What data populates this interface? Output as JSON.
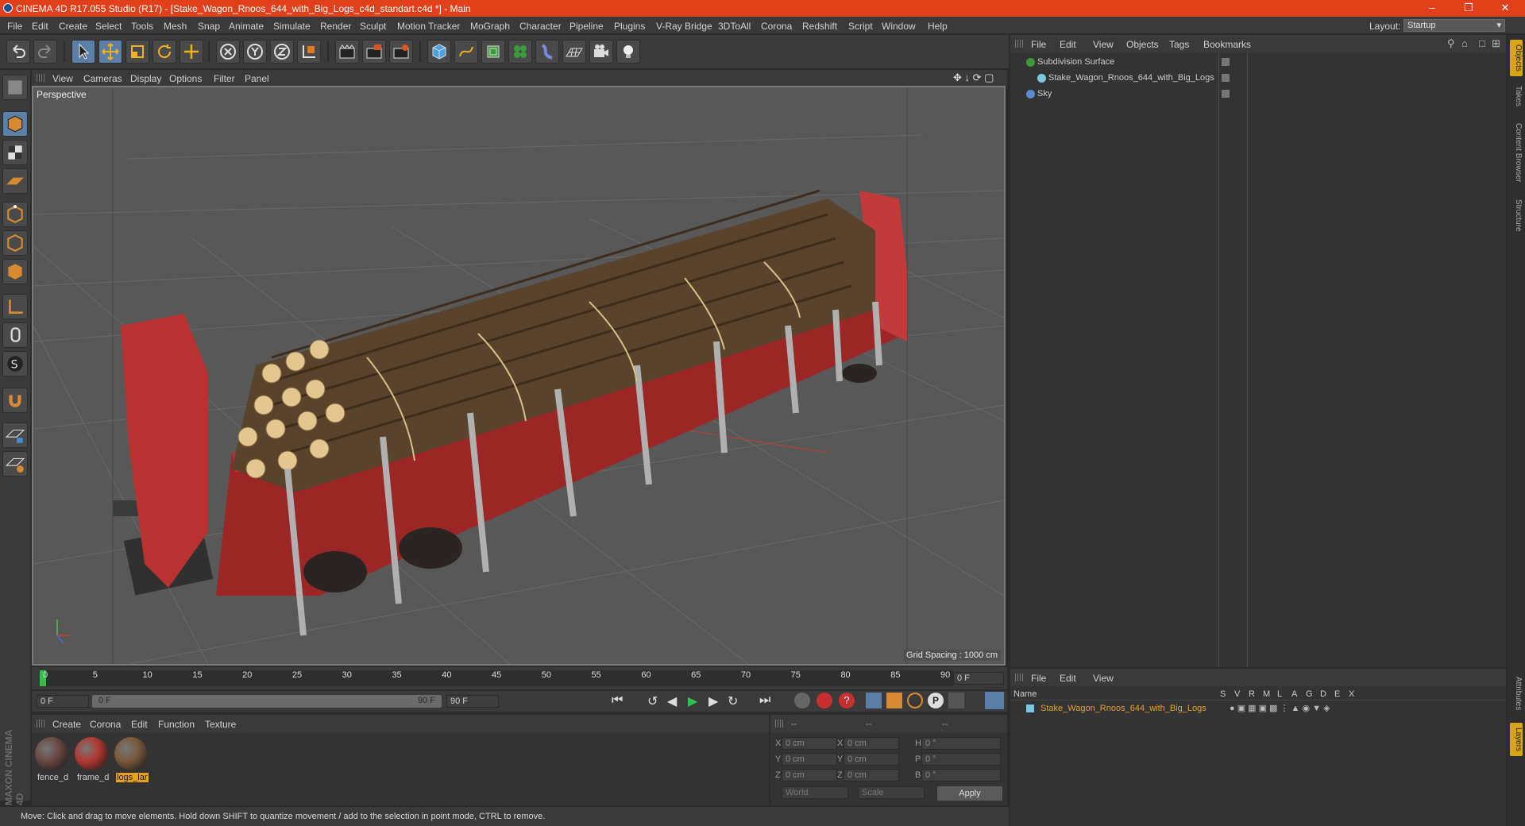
{
  "app": {
    "title": "CINEMA 4D R17.055 Studio (R17) - [Stake_Wagon_Rnoos_644_with_Big_Logs_c4d_standart.c4d *] - Main"
  },
  "menu": [
    "File",
    "Edit",
    "Create",
    "Select",
    "Tools",
    "Mesh",
    "Snap",
    "Animate",
    "Simulate",
    "Render",
    "Sculpt",
    "Motion Tracker",
    "MoGraph",
    "Character",
    "Pipeline",
    "Plugins",
    "V-Ray Bridge",
    "3DToAll",
    "Corona",
    "Redshift",
    "Script",
    "Window",
    "Help"
  ],
  "layout": {
    "label": "Layout:",
    "value": "Startup"
  },
  "toolbar_icons": [
    "undo-icon",
    "redo-icon",
    "select-arrow-icon",
    "move-icon",
    "scale-icon",
    "rotate-icon",
    "move-alt-icon",
    "x-axis-icon",
    "y-axis-icon",
    "z-axis-icon",
    "coordinate-system-icon",
    "render-view-icon",
    "render-picture-viewer-icon",
    "render-settings-icon",
    "cube-primitive-icon",
    "pen-spline-icon",
    "subdivision-icon",
    "cloner-icon",
    "deformer-icon",
    "floor-icon",
    "camera-icon",
    "light-icon"
  ],
  "left_tool_icons": [
    "make-editable-icon",
    "model-mode-icon",
    "texture-mode-icon",
    "workplane-mode-icon",
    "points-mode-icon",
    "edges-mode-icon",
    "polygons-mode-icon",
    "axis-mode-icon",
    "tweak-mode-icon",
    "snap-icon",
    "magnet-icon",
    "workplane-lock-icon",
    "solo-icon"
  ],
  "viewport": {
    "menu": [
      "View",
      "Cameras",
      "Display",
      "Options",
      "Filter",
      "Panel"
    ],
    "label": "Perspective",
    "grid_spacing": "Grid Spacing : 1000 cm"
  },
  "timeline": {
    "ticks": [
      "0",
      "5",
      "10",
      "15",
      "20",
      "25",
      "30",
      "35",
      "40",
      "45",
      "50",
      "55",
      "60",
      "65",
      "70",
      "75",
      "80",
      "85",
      "90"
    ],
    "current_frame": "0 F",
    "start_frame": "0 F",
    "range_start": "0 F",
    "range_end": "90 F",
    "end_frame": "90 F"
  },
  "materials": {
    "menu": [
      "Create",
      "Corona",
      "Edit",
      "Function",
      "Texture"
    ],
    "items": [
      {
        "name": "fence_d",
        "color": "#6a4a44"
      },
      {
        "name": "frame_d",
        "color": "#b23a34"
      },
      {
        "name": "logs_lar",
        "color": "#7a5a3e",
        "selected": true
      }
    ]
  },
  "coordinates": {
    "headers": [
      "--",
      "--",
      "--"
    ],
    "rows": [
      {
        "a": "X",
        "av": "0 cm",
        "b": "X",
        "bv": "0 cm",
        "c": "H",
        "cv": "0 °"
      },
      {
        "a": "Y",
        "av": "0 cm",
        "b": "Y",
        "bv": "0 cm",
        "c": "P",
        "cv": "0 °"
      },
      {
        "a": "Z",
        "av": "0 cm",
        "b": "Z",
        "bv": "0 cm",
        "c": "B",
        "cv": "0 °"
      }
    ],
    "mode1": "World",
    "mode2": "Scale",
    "apply": "Apply"
  },
  "status": "Move: Click and drag to move elements. Hold down SHIFT to quantize movement / add to the selection in point mode, CTRL to remove.",
  "objects": {
    "menu": [
      "File",
      "Edit",
      "View",
      "Objects",
      "Tags",
      "Bookmarks"
    ],
    "items": [
      {
        "name": "Subdivision Surface",
        "indent": 0
      },
      {
        "name": "Stake_Wagon_Rnoos_644_with_Big_Logs",
        "indent": 1
      },
      {
        "name": "Sky",
        "indent": 0
      }
    ]
  },
  "layers": {
    "menu": [
      "File",
      "Edit",
      "View"
    ],
    "name_header": "Name",
    "col_headers": [
      "S",
      "V",
      "R",
      "M",
      "L",
      "A",
      "G",
      "D",
      "E",
      "X"
    ],
    "row": "Stake_Wagon_Rnoos_644_with_Big_Logs"
  },
  "side_tabs": [
    "Objects",
    "Takes",
    "Content Browser",
    "Structure"
  ],
  "side_tabs_lower": [
    "Attributes",
    "Layers"
  ],
  "brand": "MAXON CINEMA 4D"
}
